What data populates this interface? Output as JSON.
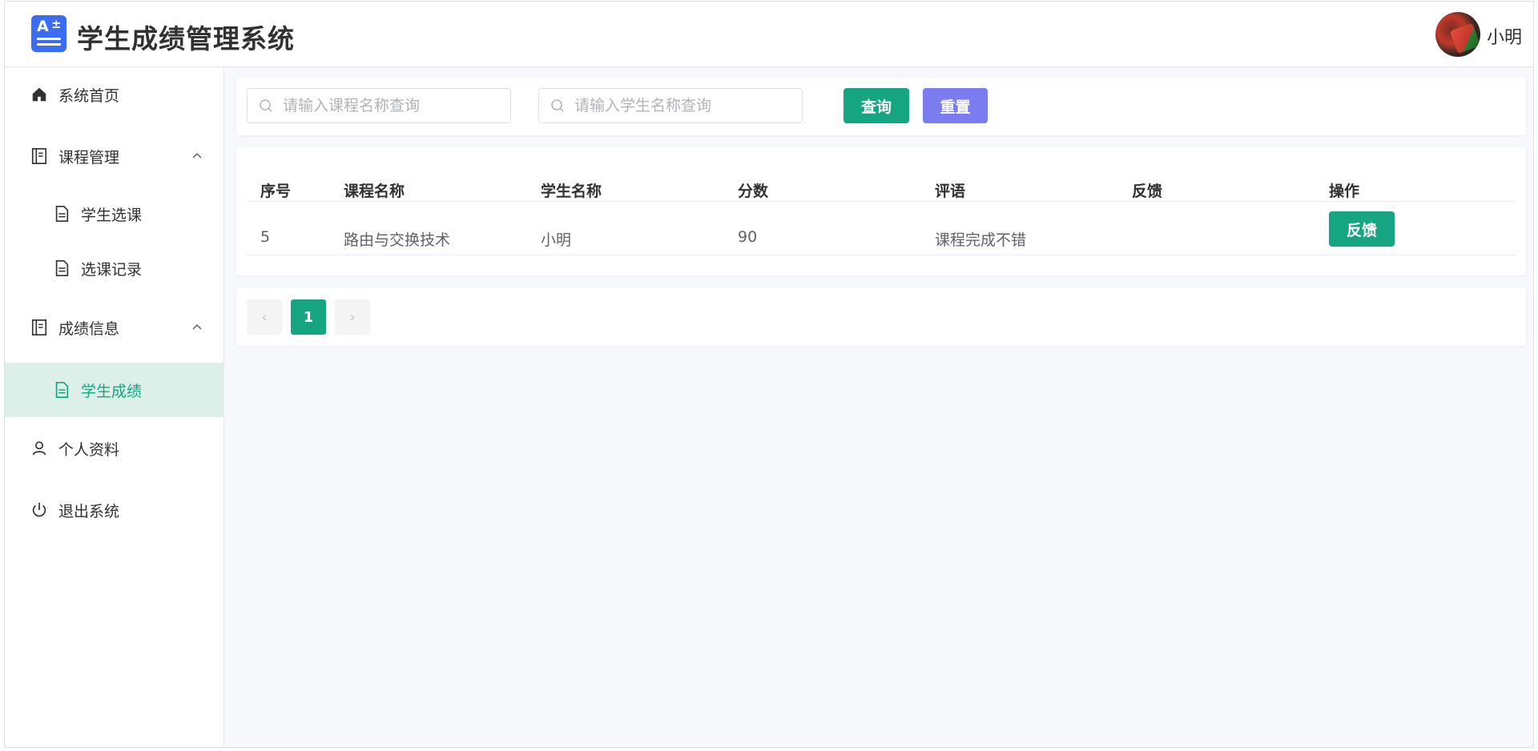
{
  "header": {
    "app_title": "学生成绩管理系统",
    "username": "小明",
    "logo_icon": "grade-a-plus-icon",
    "colors": {
      "brand": "#3b6cf6",
      "primary": "#16a581",
      "secondary": "#7a7cf0"
    }
  },
  "sidebar": {
    "home": "系统首页",
    "course_mgmt": "课程管理",
    "course_select": "学生选课",
    "course_records": "选课记录",
    "grade_info": "成绩信息",
    "student_grades": "学生成绩",
    "profile": "个人资料",
    "logout": "退出系统"
  },
  "filters": {
    "course_placeholder": "请输入课程名称查询",
    "student_placeholder": "请输入学生名称查询",
    "query_label": "查询",
    "reset_label": "重置"
  },
  "table": {
    "headers": [
      "序号",
      "课程名称",
      "学生名称",
      "分数",
      "评语",
      "反馈",
      "操作"
    ],
    "rows": [
      {
        "id": "5",
        "course": "路由与交换技术",
        "student": "小明",
        "score": "90",
        "comment": "课程完成不错",
        "feedback": "",
        "action": "反馈"
      }
    ]
  },
  "pagination": {
    "prev": "‹",
    "current": "1",
    "next": "›"
  }
}
